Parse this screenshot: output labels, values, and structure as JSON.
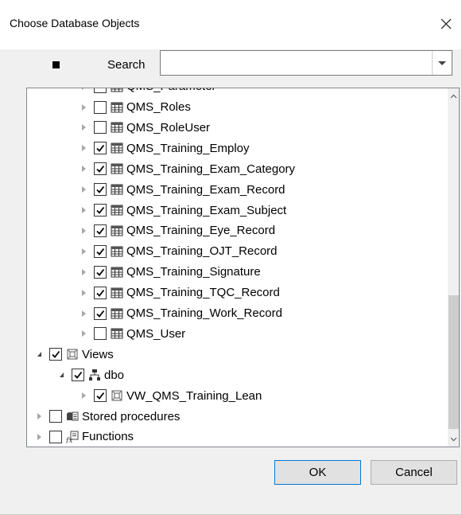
{
  "dialog": {
    "title": "Choose Database Objects",
    "close_icon": "close-icon"
  },
  "toolbar": {
    "select_all_state": "indeterminate",
    "search_label": "Search",
    "search_value": "",
    "search_placeholder": ""
  },
  "tree": {
    "partial_top_label": "QMS_Parameter",
    "tables": [
      {
        "label": "QMS_Roles",
        "checked": false
      },
      {
        "label": "QMS_RoleUser",
        "checked": false
      },
      {
        "label": "QMS_Training_Employ",
        "checked": true
      },
      {
        "label": "QMS_Training_Exam_Category",
        "checked": true
      },
      {
        "label": "QMS_Training_Exam_Record",
        "checked": true
      },
      {
        "label": "QMS_Training_Exam_Subject",
        "checked": true
      },
      {
        "label": "QMS_Training_Eye_Record",
        "checked": true
      },
      {
        "label": "QMS_Training_OJT_Record",
        "checked": true
      },
      {
        "label": "QMS_Training_Signature",
        "checked": true
      },
      {
        "label": "QMS_Training_TQC_Record",
        "checked": true
      },
      {
        "label": "QMS_Training_Work_Record",
        "checked": true
      },
      {
        "label": "QMS_User",
        "checked": false
      }
    ],
    "views_label": "Views",
    "views_schema_label": "dbo",
    "view_items": [
      {
        "label": "VW_QMS_Training_Lean",
        "checked": true
      }
    ],
    "stored_procedures_label": "Stored procedures",
    "functions_label": "Functions"
  },
  "buttons": {
    "ok_label": "OK",
    "cancel_label": "Cancel"
  }
}
